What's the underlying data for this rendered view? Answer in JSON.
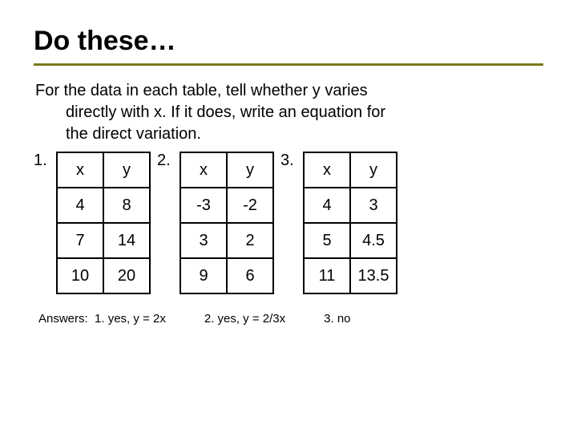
{
  "title": "Do these…",
  "prompt_line1": "For the data in each table, tell whether y varies",
  "prompt_line2": "directly with x.  If it does, write an equation for",
  "prompt_line3": "the direct variation.",
  "problems": [
    {
      "label": "1.",
      "headers": [
        "x",
        "y"
      ],
      "rows": [
        [
          "4",
          "8"
        ],
        [
          "7",
          "14"
        ],
        [
          "10",
          "20"
        ]
      ]
    },
    {
      "label": "2.",
      "headers": [
        "x",
        "y"
      ],
      "rows": [
        [
          "-3",
          "-2"
        ],
        [
          "3",
          "2"
        ],
        [
          "9",
          "6"
        ]
      ]
    },
    {
      "label": "3.",
      "headers": [
        "x",
        "y"
      ],
      "rows": [
        [
          "4",
          "3"
        ],
        [
          "5",
          "4.5"
        ],
        [
          "11",
          "13.5"
        ]
      ]
    }
  ],
  "answers": {
    "prefix": "Answers:",
    "items": [
      "1.  yes, y = 2x",
      "2.  yes, y = 2/3x",
      "3.  no"
    ]
  },
  "chart_data": [
    {
      "type": "table",
      "title": "Problem 1",
      "headers": [
        "x",
        "y"
      ],
      "rows": [
        [
          4,
          8
        ],
        [
          7,
          14
        ],
        [
          10,
          20
        ]
      ]
    },
    {
      "type": "table",
      "title": "Problem 2",
      "headers": [
        "x",
        "y"
      ],
      "rows": [
        [
          -3,
          -2
        ],
        [
          3,
          2
        ],
        [
          9,
          6
        ]
      ]
    },
    {
      "type": "table",
      "title": "Problem 3",
      "headers": [
        "x",
        "y"
      ],
      "rows": [
        [
          4,
          3
        ],
        [
          5,
          4.5
        ],
        [
          11,
          13.5
        ]
      ]
    }
  ]
}
